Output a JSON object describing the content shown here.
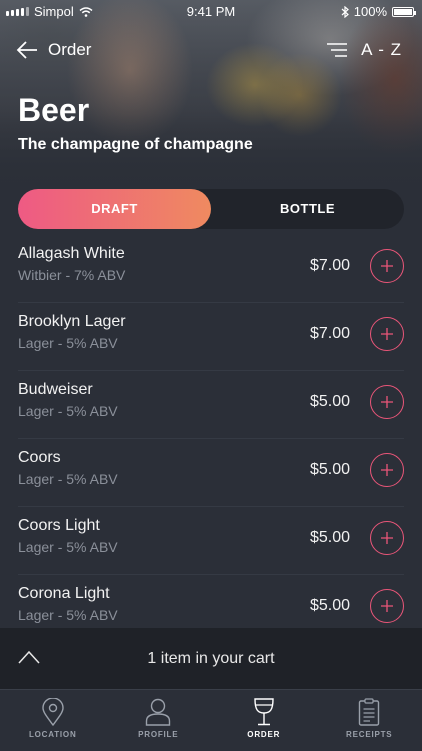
{
  "status": {
    "carrier": "Simpol",
    "time": "9:41 PM",
    "battery": "100%"
  },
  "nav": {
    "back_label": "Order",
    "sort_label": "A - Z"
  },
  "header": {
    "title": "Beer",
    "subtitle": "The champagne of champagne"
  },
  "toggle": {
    "active": "DRAFT",
    "inactive": "BOTTLE"
  },
  "items": [
    {
      "name": "Allagash White",
      "desc": "Witbier  - 7% ABV",
      "price": "$7.00"
    },
    {
      "name": "Brooklyn Lager",
      "desc": "Lager - 5% ABV",
      "price": "$7.00"
    },
    {
      "name": "Budweiser",
      "desc": "Lager - 5% ABV",
      "price": "$5.00"
    },
    {
      "name": "Coors",
      "desc": "Lager - 5% ABV",
      "price": "$5.00"
    },
    {
      "name": "Coors Light",
      "desc": "Lager - 5% ABV",
      "price": "$5.00"
    },
    {
      "name": "Corona Light",
      "desc": "Lager - 5% ABV",
      "price": "$5.00"
    }
  ],
  "cart": {
    "text": "1 item in your cart"
  },
  "tabs": [
    {
      "label": "LOCATION",
      "icon": "location-pin-icon"
    },
    {
      "label": "PROFILE",
      "icon": "profile-icon"
    },
    {
      "label": "ORDER",
      "icon": "wine-glass-icon"
    },
    {
      "label": "RECEIPTS",
      "icon": "receipt-icon"
    }
  ],
  "colors": {
    "accent": "#ea5679",
    "gradient_start": "#ee5a84",
    "gradient_end": "#ef8a60",
    "background": "#2b2f38"
  }
}
